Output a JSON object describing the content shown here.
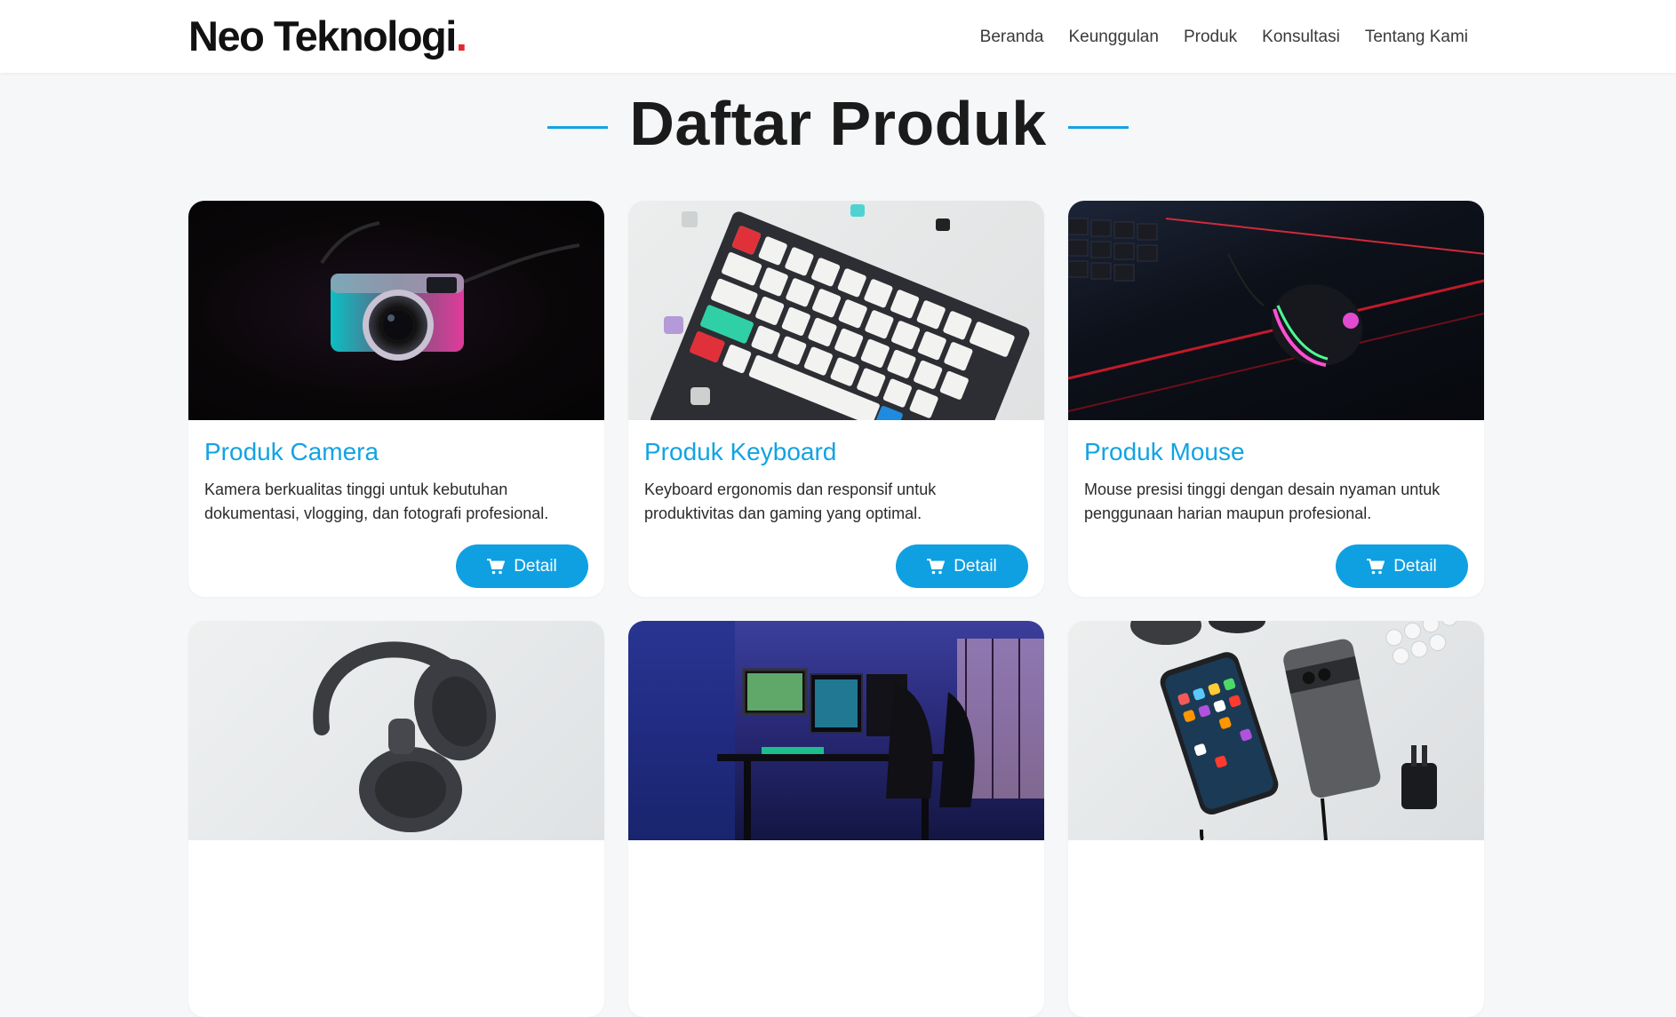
{
  "brand": {
    "name": "Neo Teknologi",
    "dot": "."
  },
  "nav": {
    "items": [
      {
        "label": "Beranda"
      },
      {
        "label": "Keunggulan"
      },
      {
        "label": "Produk"
      },
      {
        "label": "Konsultasi"
      },
      {
        "label": "Tentang Kami"
      }
    ]
  },
  "section": {
    "title": "Daftar Produk"
  },
  "colors": {
    "accent": "#12a3e3",
    "brand_dot": "#e8252c",
    "button": "#0fa0e2"
  },
  "products": [
    {
      "title": "Produk Camera",
      "description": "Kamera berkualitas tinggi untuk kebutuhan dokumentasi, vlogging, dan fotografi profesional.",
      "button": "Detail",
      "image": "camera-photo"
    },
    {
      "title": "Produk Keyboard",
      "description": "Keyboard ergonomis dan responsif untuk produktivitas dan gaming yang optimal.",
      "button": "Detail",
      "image": "keyboard-photo"
    },
    {
      "title": "Produk Mouse",
      "description": "Mouse presisi tinggi dengan desain nyaman untuk penggunaan harian maupun profesional.",
      "button": "Detail",
      "image": "mouse-photo"
    },
    {
      "image": "headphones-photo"
    },
    {
      "image": "gaming-setup-photo"
    },
    {
      "image": "smartphone-photo"
    }
  ]
}
